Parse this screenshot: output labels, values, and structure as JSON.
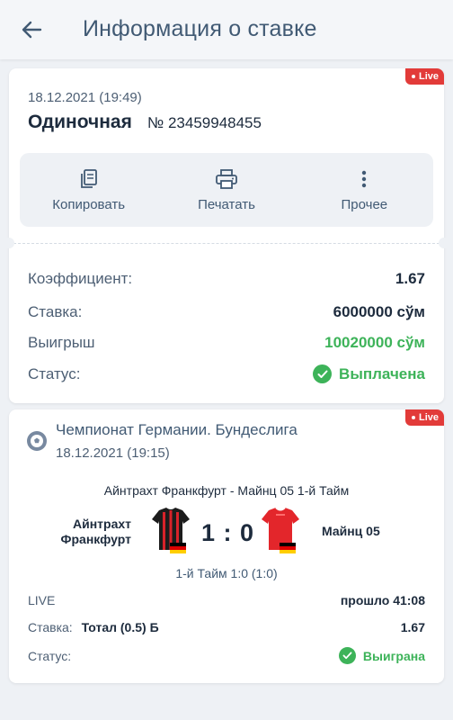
{
  "header": {
    "title": "Информация о ставке",
    "back_icon": "arrow-left-icon"
  },
  "bet": {
    "live_label": "Live",
    "date": "18.12.2021 (19:49)",
    "type": "Одиночная",
    "number": "№ 23459948455",
    "actions": [
      {
        "label": "Копировать",
        "icon": "copy-icon"
      },
      {
        "label": "Печатать",
        "icon": "print-icon"
      },
      {
        "label": "Прочее",
        "icon": "more-vertical-icon"
      }
    ],
    "details": {
      "coefficient_label": "Коэффициент:",
      "coefficient_value": "1.67",
      "stake_label": "Ставка:",
      "stake_value": "6000000 сўм",
      "win_label": "Выигрыш",
      "win_value": "10020000 сўм",
      "status_label": "Статус:",
      "status_value": "Выплачена"
    }
  },
  "event": {
    "live_label": "Live",
    "league": "Чемпионат Германии. Бундеслига",
    "date": "18.12.2021 (19:15)",
    "match_title": "Айнтрахт Франкфурт - Майнц 05 1-й Тайм",
    "team_home": "Айнтрахт Франкфурт",
    "team_away": "Майнц 05",
    "score": "1 : 0",
    "period": "1-й Тайм 1:0 (1:0)",
    "live_text": "LIVE",
    "elapsed": "прошло 41:08",
    "bet_label": "Ставка:",
    "bet_market": "Тотал (0.5) Б",
    "bet_odds": "1.67",
    "status_label": "Статус:",
    "status_value": "Выиграна"
  },
  "colors": {
    "accent": "#415a74",
    "win": "#3db359",
    "live": "#e23b39",
    "background": "#eef1f5"
  }
}
